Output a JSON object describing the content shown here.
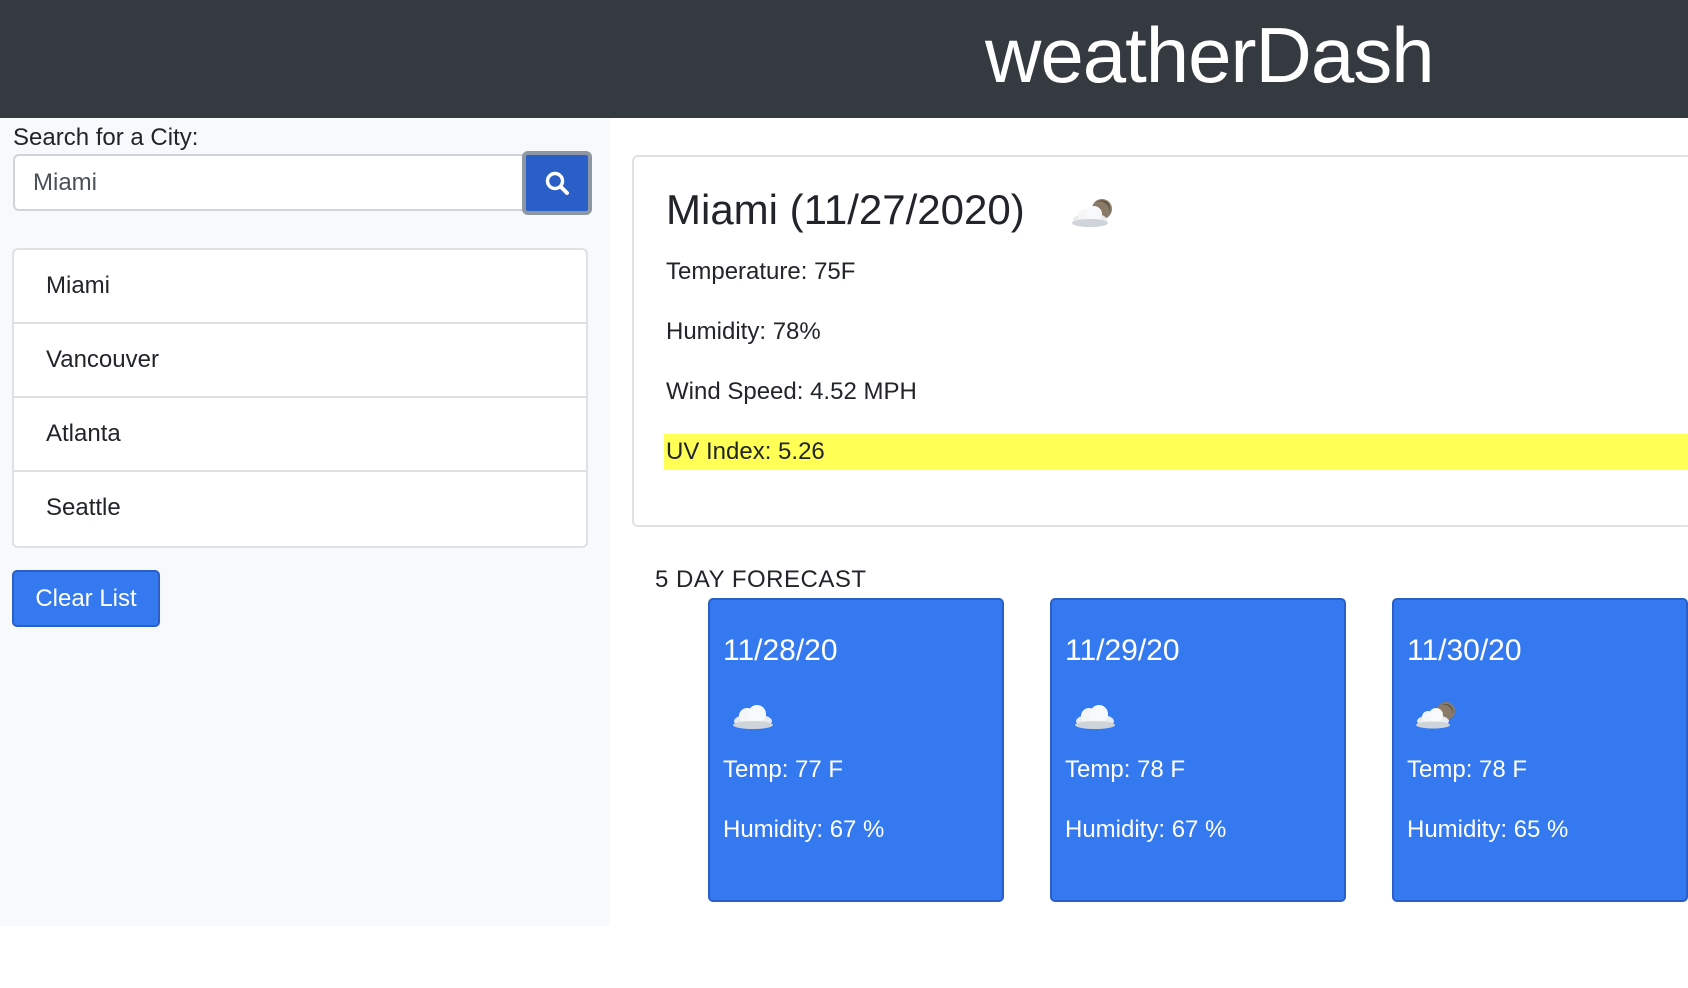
{
  "header": {
    "brand": "weatherDash"
  },
  "sidebar": {
    "search_label": "Search for a City:",
    "search_value": "Miami",
    "cities": [
      "Miami",
      "Vancouver",
      "Atlanta",
      "Seattle"
    ],
    "clear_label": "Clear List"
  },
  "current": {
    "title": "Miami (11/27/2020)",
    "icon": "partly-cloudy-night-icon",
    "temperature": "Temperature: 75F",
    "humidity": "Humidity: 78%",
    "wind": "Wind Speed: 4.52 MPH",
    "uv": "UV Index: 5.26",
    "uv_color": "#ffff55"
  },
  "forecast": {
    "heading": "5 DAY FORECAST",
    "days": [
      {
        "date": "11/28/20",
        "icon": "cloud-icon",
        "temp": "Temp: 77 F",
        "humidity": "Humidity: 67 %"
      },
      {
        "date": "11/29/20",
        "icon": "cloud-icon",
        "temp": "Temp: 78 F",
        "humidity": "Humidity: 67 %"
      },
      {
        "date": "11/30/20",
        "icon": "partly-cloudy-night-icon",
        "temp": "Temp: 78 F",
        "humidity": "Humidity: 65 %"
      }
    ]
  },
  "colors": {
    "navbar": "#343a40",
    "accent": "#3479f0",
    "search_button": "#2a5fc7"
  }
}
